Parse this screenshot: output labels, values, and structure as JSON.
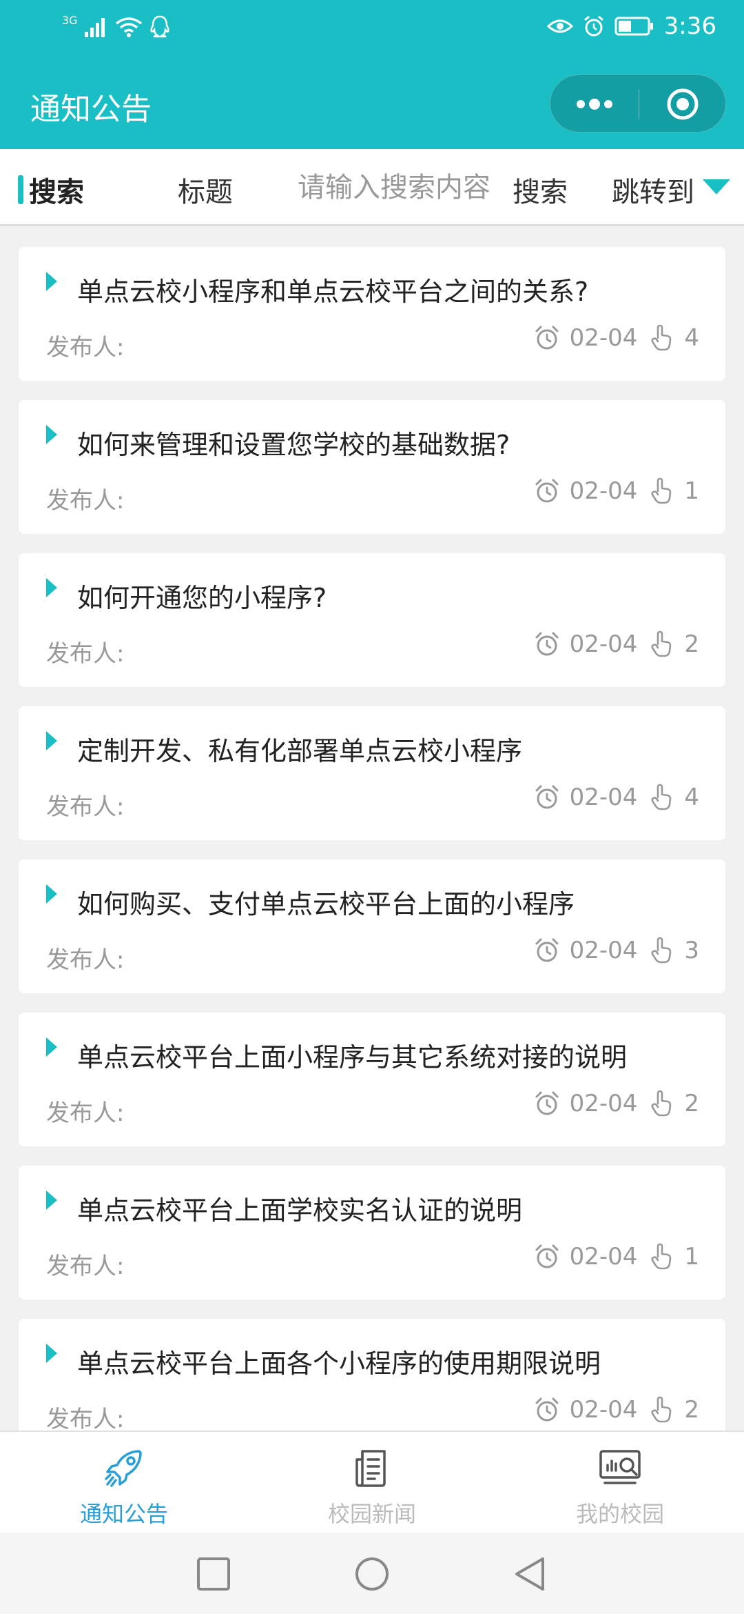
{
  "status_bar": {
    "network": "3G",
    "time": "3:36",
    "icons": [
      "signal-icon",
      "wifi-icon",
      "qq-icon",
      "eye-icon",
      "alarm-icon",
      "battery-icon"
    ]
  },
  "navbar": {
    "title": "通知公告"
  },
  "search": {
    "label": "搜索",
    "field": "标题",
    "placeholder": "请输入搜索内容",
    "button": "搜索",
    "jump": "跳转到"
  },
  "notices": [
    {
      "title": "单点云校小程序和单点云校平台之间的关系?",
      "author_label": "发布人:",
      "date": "02-04",
      "views": "4"
    },
    {
      "title": "如何来管理和设置您学校的基础数据?",
      "author_label": "发布人:",
      "date": "02-04",
      "views": "1"
    },
    {
      "title": "如何开通您的小程序?",
      "author_label": "发布人:",
      "date": "02-04",
      "views": "2"
    },
    {
      "title": "定制开发、私有化部署单点云校小程序",
      "author_label": "发布人:",
      "date": "02-04",
      "views": "4"
    },
    {
      "title": "如何购买、支付单点云校平台上面的小程序",
      "author_label": "发布人:",
      "date": "02-04",
      "views": "3"
    },
    {
      "title": "单点云校平台上面小程序与其它系统对接的说明",
      "author_label": "发布人:",
      "date": "02-04",
      "views": "2"
    },
    {
      "title": "单点云校平台上面学校实名认证的说明",
      "author_label": "发布人:",
      "date": "02-04",
      "views": "1"
    },
    {
      "title": "单点云校平台上面各个小程序的使用期限说明",
      "author_label": "发布人:",
      "date": "02-04",
      "views": "2"
    }
  ],
  "tabbar": [
    {
      "label": "通知公告",
      "icon": "rocket-icon",
      "active": true
    },
    {
      "label": "校园新闻",
      "icon": "newspaper-icon",
      "active": false
    },
    {
      "label": "我的校园",
      "icon": "campus-monitor-icon",
      "active": false
    }
  ],
  "colors": {
    "brand": "#1abfc6",
    "active_tab": "#2a9fd6",
    "muted_text": "#999999"
  }
}
